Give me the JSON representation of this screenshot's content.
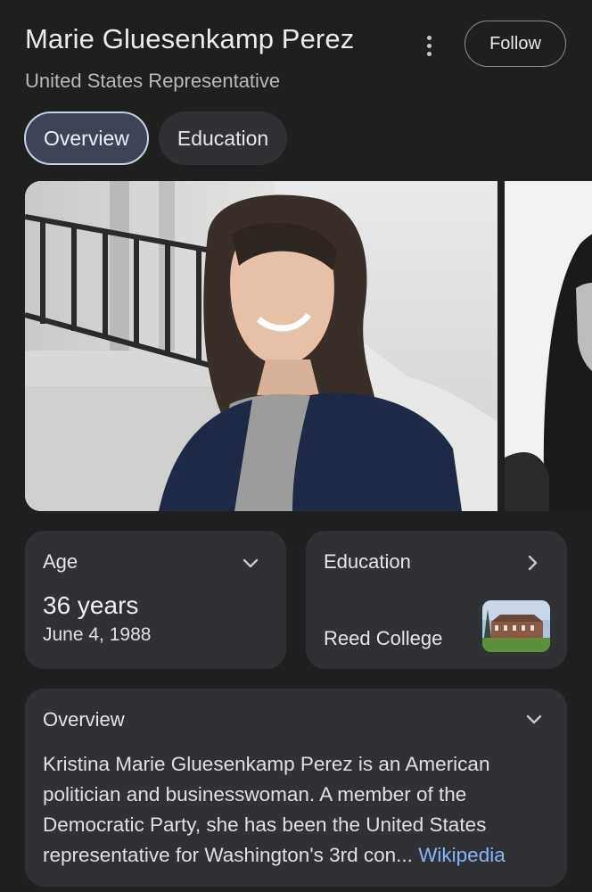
{
  "header": {
    "title": "Marie Gluesenkamp Perez",
    "subtitle": "United States Representative",
    "follow_label": "Follow"
  },
  "tabs": [
    {
      "label": "Overview",
      "active": true
    },
    {
      "label": "Education",
      "active": false
    }
  ],
  "age_card": {
    "label": "Age",
    "value": "36 years",
    "date": "June 4, 1988",
    "icon": "chevron-down-icon"
  },
  "education_card": {
    "label": "Education",
    "value": "Reed College",
    "icon": "chevron-right-icon"
  },
  "overview_card": {
    "label": "Overview",
    "lines": [
      "Kristina Marie Gluesenkamp Perez is an American",
      "politician and businesswoman. A member of the",
      "Democratic Party, she has been the United States",
      "representative for Washington's 3rd con..."
    ],
    "source_link": "Wikipedia",
    "icon": "chevron-down-icon"
  },
  "colors": {
    "background": "#1f1f1f",
    "card": "#303134",
    "active_tab": "#3c4456",
    "link": "#8ab4f8"
  }
}
